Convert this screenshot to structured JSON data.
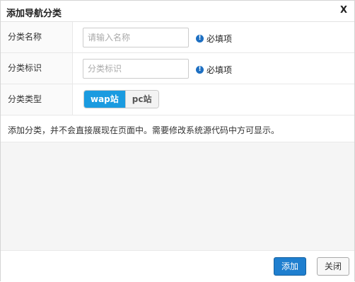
{
  "dialog": {
    "title": "添加导航分类",
    "close_label": "X"
  },
  "form": {
    "name": {
      "label": "分类名称",
      "placeholder": "请输入名称",
      "value": "",
      "required_text": "必填项",
      "required_icon": "info-icon"
    },
    "identifier": {
      "label": "分类标识",
      "placeholder": "分类标识",
      "value": "",
      "required_text": "必填项",
      "required_icon": "info-icon"
    },
    "type": {
      "label": "分类类型",
      "options": [
        "wap站",
        "pc站"
      ],
      "selected": "wap站"
    }
  },
  "note": "添加分类，并不会直接展现在页面中。需要修改系统源代码中方可显示。",
  "footer": {
    "add_label": "添加",
    "close_label": "关闭"
  },
  "colors": {
    "primary": "#1f7fcf",
    "toggle_active": "#1a9be0",
    "info_icon": "#1d6fc2"
  }
}
